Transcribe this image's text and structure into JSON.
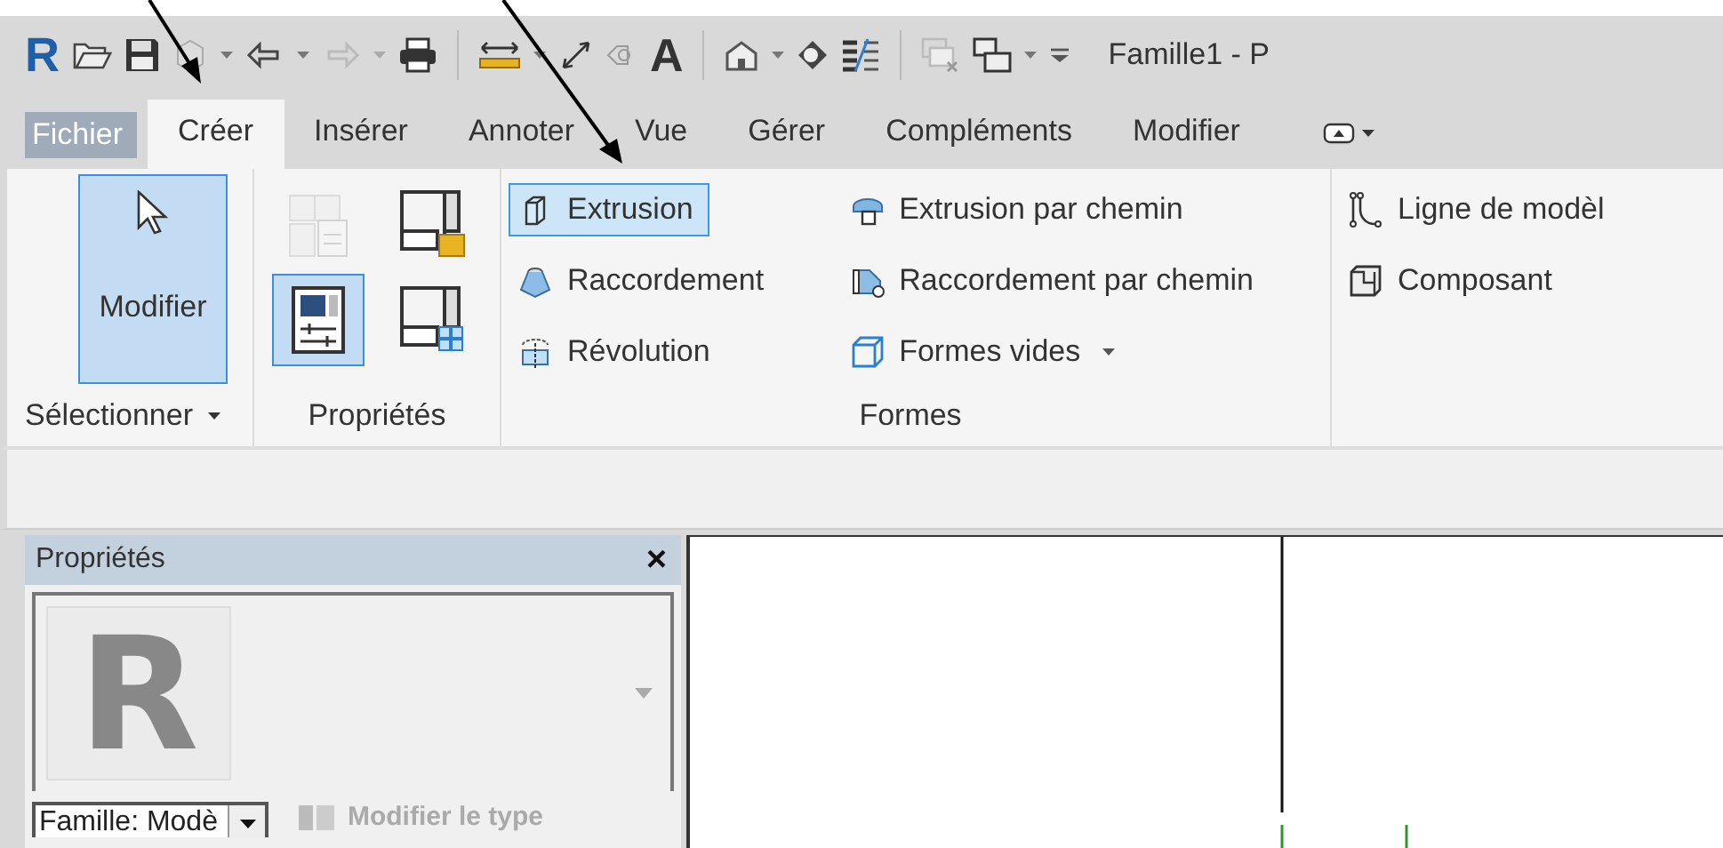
{
  "app_logo": "R",
  "quick_access": {
    "text_glyph": "A"
  },
  "title": "Famille1 - P",
  "tabs": [
    {
      "label": "Fichier",
      "kind": "file",
      "selected": false
    },
    {
      "label": "Créer",
      "kind": "tab",
      "selected": true
    },
    {
      "label": "Insérer",
      "kind": "tab",
      "selected": false
    },
    {
      "label": "Annoter",
      "kind": "tab",
      "selected": false
    },
    {
      "label": "Vue",
      "kind": "tab",
      "selected": false
    },
    {
      "label": "Gérer",
      "kind": "tab",
      "selected": false
    },
    {
      "label": "Compléments",
      "kind": "tab",
      "selected": false
    },
    {
      "label": "Modifier",
      "kind": "tab",
      "selected": false
    }
  ],
  "ribbon": {
    "select_panel": {
      "button": {
        "label": "Modifier",
        "selected": true
      },
      "title": "Sélectionner"
    },
    "properties_panel": {
      "buttons": [
        {
          "kind": "family-types",
          "selected": false,
          "disabled": true
        },
        {
          "kind": "load-family",
          "selected": false,
          "disabled": false
        },
        {
          "kind": "properties",
          "selected": true,
          "disabled": false
        },
        {
          "kind": "family-category",
          "selected": false,
          "disabled": false
        }
      ],
      "title": "Propriétés"
    },
    "forms_panel": {
      "items": [
        {
          "label": "Extrusion",
          "kind": "extrusion",
          "selected": true,
          "dropdown": false
        },
        {
          "label": "Raccordement",
          "kind": "blend",
          "selected": false,
          "dropdown": false
        },
        {
          "label": "Révolution",
          "kind": "revolve",
          "selected": false,
          "dropdown": false
        },
        {
          "label": "Extrusion par chemin",
          "kind": "sweep",
          "selected": false,
          "dropdown": false
        },
        {
          "label": "Raccordement par chemin",
          "kind": "swept-blend",
          "selected": false,
          "dropdown": false
        },
        {
          "label": "Formes vides",
          "kind": "void",
          "selected": false,
          "dropdown": true
        }
      ],
      "title": "Formes"
    },
    "model_panel": {
      "items": [
        {
          "label": "Ligne de modèl",
          "kind": "model-line"
        },
        {
          "label": "Composant",
          "kind": "component"
        }
      ]
    }
  },
  "properties": {
    "title": "Propriétés",
    "close": "×",
    "preview_logo": "R",
    "family_selector": "Famille: Modè",
    "edit_type": {
      "label": "Modifier le type",
      "disabled": true
    }
  }
}
